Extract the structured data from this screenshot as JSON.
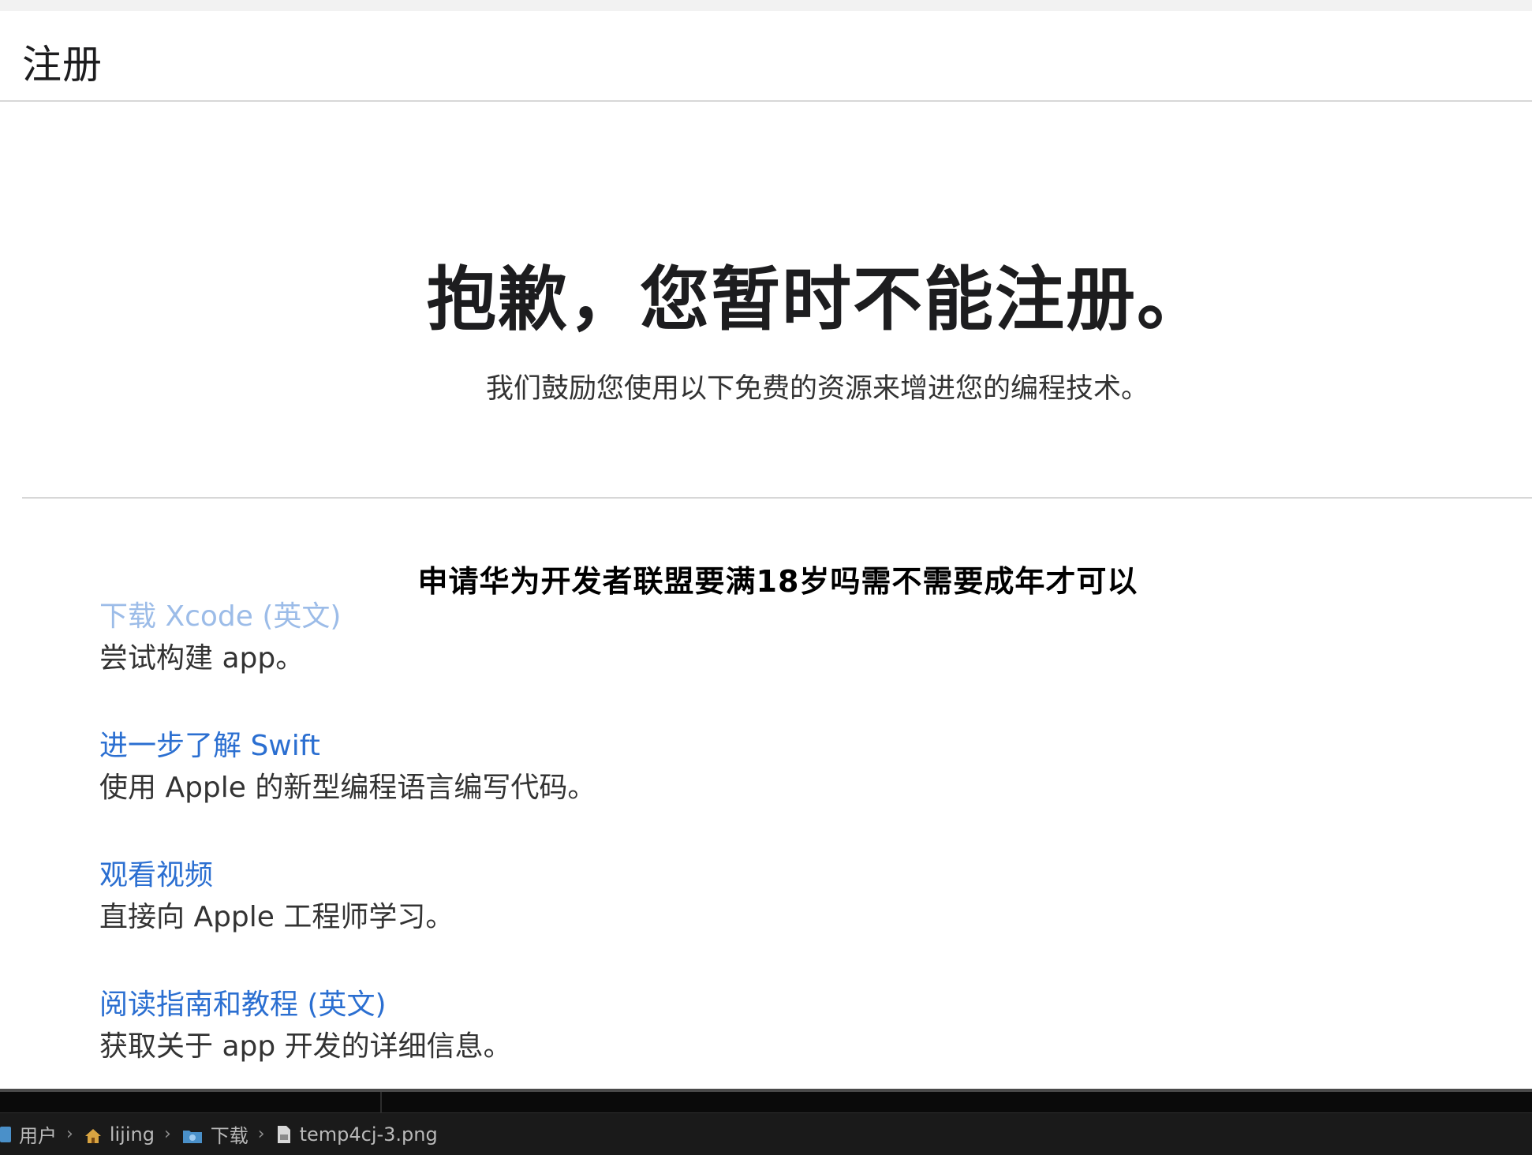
{
  "header": {
    "title": "注册"
  },
  "hero": {
    "title": "抱歉，您暂时不能注册。",
    "subtitle": "我们鼓励您使用以下免费的资源来增进您的编程技术。"
  },
  "overlay": {
    "caption": "申请华为开发者联盟要满18岁吗需不需要成年才可以"
  },
  "resources": [
    {
      "link": "下载 Xcode (英文)",
      "description": "尝试构建 app。"
    },
    {
      "link": "进一步了解 Swift",
      "description": "使用 Apple 的新型编程语言编写代码。"
    },
    {
      "link": "观看视频",
      "description": "直接向 Apple 工程师学习。"
    },
    {
      "link": "阅读指南和教程 (英文)",
      "description": "获取关于 app 开发的详细信息。"
    }
  ],
  "breadcrumb": {
    "items": [
      "用户",
      "lijing",
      "下载",
      "temp4cj-3.png"
    ],
    "separator": "›"
  },
  "colors": {
    "link": "#2b6fd1",
    "link_faded": "#9cbce8",
    "text": "#1d1d1f",
    "status_bar": "#1a1a1a"
  }
}
